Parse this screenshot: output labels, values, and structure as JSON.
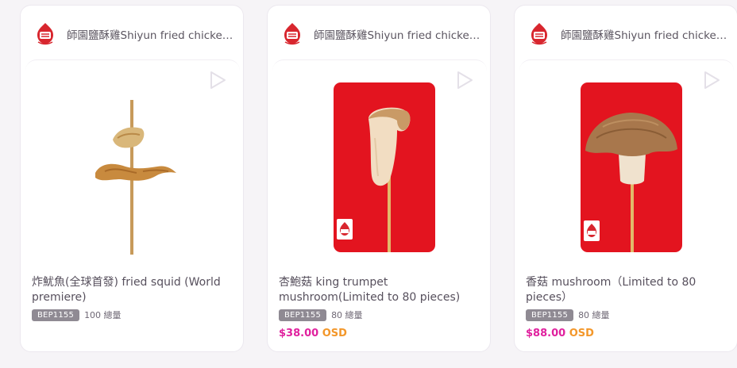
{
  "products": [
    {
      "shop_name": "師園鹽酥雞Shiyun fried chicken ...",
      "title": "炸魷魚(全球首發) fried squid (World premiere)",
      "code": "BEP1155",
      "quantity": "100 總量",
      "price_amount": "",
      "price_currency": ""
    },
    {
      "shop_name": "師園鹽酥雞Shiyun fried chicken ...",
      "title": "杏鮑菇 king trumpet mushroom(Limited to 80 pieces)",
      "code": "BEP1155",
      "quantity": "80 總量",
      "price_amount": "$38.00",
      "price_currency": "OSD"
    },
    {
      "shop_name": "師園鹽酥雞Shiyun fried chicken ...",
      "title": "香菇 mushroom（Limited to 80 pieces）",
      "code": "BEP1155",
      "quantity": "80 總量",
      "price_amount": "$88.00",
      "price_currency": "OSD"
    }
  ],
  "icons": {
    "logo": "shiyun-logo-icon",
    "play": "play-icon"
  },
  "colors": {
    "price_amount": "#e0219e",
    "price_currency": "#f3972a",
    "photo_background": "#e3141f",
    "badge": "#8f8a93"
  }
}
